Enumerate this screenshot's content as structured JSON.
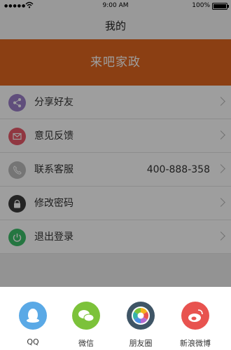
{
  "status_bar": {
    "time": "9:00 AM",
    "battery": "100%"
  },
  "nav": {
    "title": "我的"
  },
  "banner": {
    "title": "来吧家政",
    "color": "#e0661f"
  },
  "menu": [
    {
      "label": "分享好友",
      "icon": "share-icon",
      "color": "#9b7fc9"
    },
    {
      "label": "意见反馈",
      "icon": "mail-icon",
      "color": "#e85a6a"
    },
    {
      "label": "联系客服",
      "icon": "phone-icon",
      "color": "#bdbdbd",
      "value": "400-888-358"
    },
    {
      "label": "修改密码",
      "icon": "lock-icon",
      "color": "#3a3a3a"
    },
    {
      "label": "退出登录",
      "icon": "power-icon",
      "color": "#3cbf6a"
    }
  ],
  "share_sheet": [
    {
      "label": "QQ",
      "icon": "qq-icon",
      "color": "#5aa9e6"
    },
    {
      "label": "微信",
      "icon": "wechat-icon",
      "color": "#7cc23a"
    },
    {
      "label": "朋友圈",
      "icon": "moments-icon",
      "color": "#3f5566"
    },
    {
      "label": "新浪微博",
      "icon": "weibo-icon",
      "color": "#e8534f"
    }
  ]
}
